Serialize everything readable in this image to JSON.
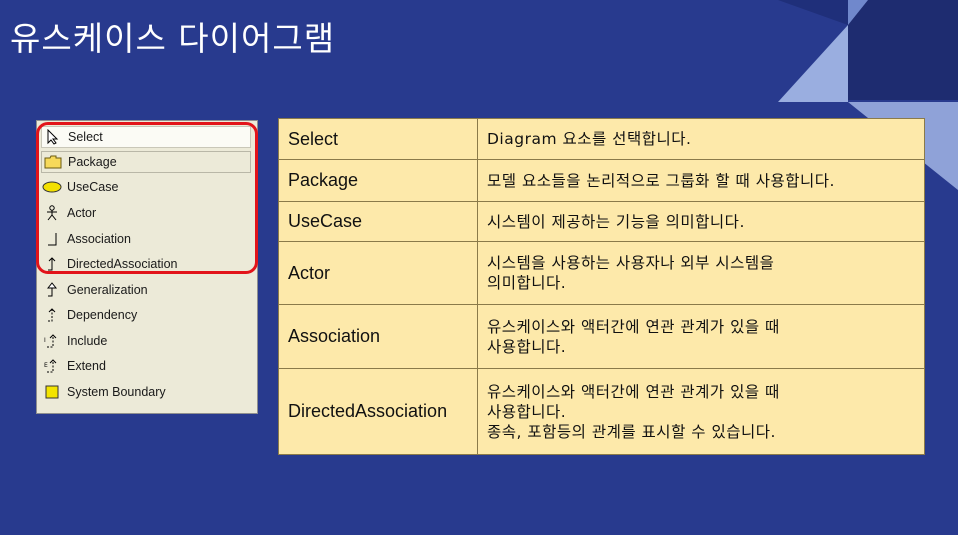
{
  "slide": {
    "title": "유스케이스 다이어그램"
  },
  "colors": {
    "background": "#283a8e",
    "table_fill": "#fde9aa",
    "highlight": "#e2141a"
  },
  "toolbox": {
    "items": [
      {
        "label": "Select",
        "icon": "cursor-arrow-icon"
      },
      {
        "label": "Package",
        "icon": "folder-icon"
      },
      {
        "label": "UseCase",
        "icon": "ellipse-icon"
      },
      {
        "label": "Actor",
        "icon": "stick-figure-icon"
      },
      {
        "label": "Association",
        "icon": "association-line-icon"
      },
      {
        "label": "DirectedAssociation",
        "icon": "directed-arrow-icon"
      },
      {
        "label": "Generalization",
        "icon": "generalization-arrow-icon"
      },
      {
        "label": "Dependency",
        "icon": "dependency-arrow-icon"
      },
      {
        "label": "Include",
        "icon": "include-arrow-icon"
      },
      {
        "label": "Extend",
        "icon": "extend-arrow-icon"
      },
      {
        "label": "System Boundary",
        "icon": "yellow-square-icon"
      }
    ]
  },
  "table": {
    "rows": [
      {
        "key": "Select",
        "lines": [
          "Diagram 요소를 선택합니다."
        ]
      },
      {
        "key": "Package",
        "lines": [
          "모델 요소들을 논리적으로 그룹화 할 때 사용합니다."
        ]
      },
      {
        "key": "UseCase",
        "lines": [
          "시스템이 제공하는 기능을 의미합니다."
        ]
      },
      {
        "key": "Actor",
        "lines": [
          "시스템을 사용하는 사용자나 외부 시스템을",
          "의미합니다."
        ]
      },
      {
        "key": "Association",
        "lines": [
          "유스케이스와 액터간에 연관 관계가 있을 때",
          "사용합니다."
        ]
      },
      {
        "key": "DirectedAssociation",
        "lines": [
          "유스케이스와 액터간에 연관 관계가 있을 때",
          "사용합니다.",
          "종속, 포함등의 관계를 표시할 수 있습니다."
        ]
      }
    ]
  }
}
